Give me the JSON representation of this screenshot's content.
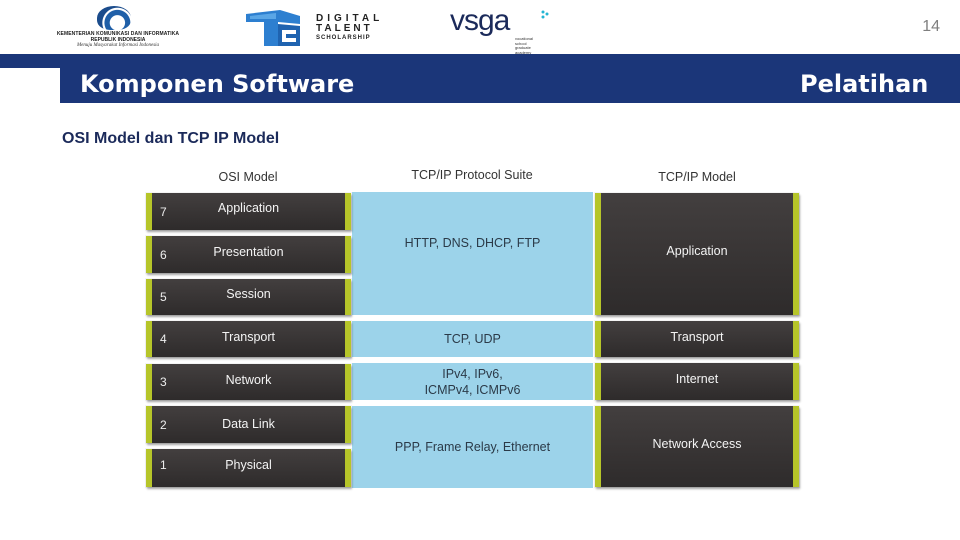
{
  "header": {
    "logos": {
      "kominfo": {
        "line1": "KEMENTERIAN KOMUNIKASI DAN INFORMATIKA",
        "line2": "REPUBLIK INDONESIA",
        "tagline": "Menuju Masyarakat Informasi Indonesia"
      },
      "dts": {
        "line1": "DIGITAL",
        "line2": "TALENT",
        "line3": "SCHOLARSHIP"
      },
      "vsga": {
        "word": "vsga",
        "sub": [
          "vocational",
          "school",
          "graduate",
          "academy"
        ]
      }
    },
    "page_number": "14"
  },
  "banner": {
    "title_left": "Komponen Software",
    "title_right": "Pelatihan"
  },
  "content": {
    "subtitle": "OSI Model dan TCP IP Model",
    "diagram": {
      "osi_heading": "OSI Model",
      "suite_heading": "TCP/IP Protocol Suite",
      "tcpip_heading": "TCP/IP Model",
      "osi_layers": [
        {
          "num": "7",
          "name": "Application"
        },
        {
          "num": "6",
          "name": "Presentation"
        },
        {
          "num": "5",
          "name": "Session"
        },
        {
          "num": "4",
          "name": "Transport"
        },
        {
          "num": "3",
          "name": "Network"
        },
        {
          "num": "2",
          "name": "Data Link"
        },
        {
          "num": "1",
          "name": "Physical"
        }
      ],
      "protocol_suite": [
        {
          "line1": "HTTP, DNS, DHCP, FTP",
          "line2": ""
        },
        {
          "line1": "TCP, UDP",
          "line2": ""
        },
        {
          "line1": "IPv4, IPv6,",
          "line2": "ICMPv4, ICMPv6"
        },
        {
          "line1": "PPP, Frame Relay, Ethernet",
          "line2": ""
        }
      ],
      "tcpip_layers": [
        {
          "name": "Application"
        },
        {
          "name": "Transport"
        },
        {
          "name": "Internet"
        },
        {
          "name": "Network Access"
        }
      ],
      "colors": {
        "banner": "#1b3679",
        "layer_box": "#3a3636",
        "accent_green": "#b6c529",
        "suite_blue": "#9cd3ea"
      }
    }
  }
}
